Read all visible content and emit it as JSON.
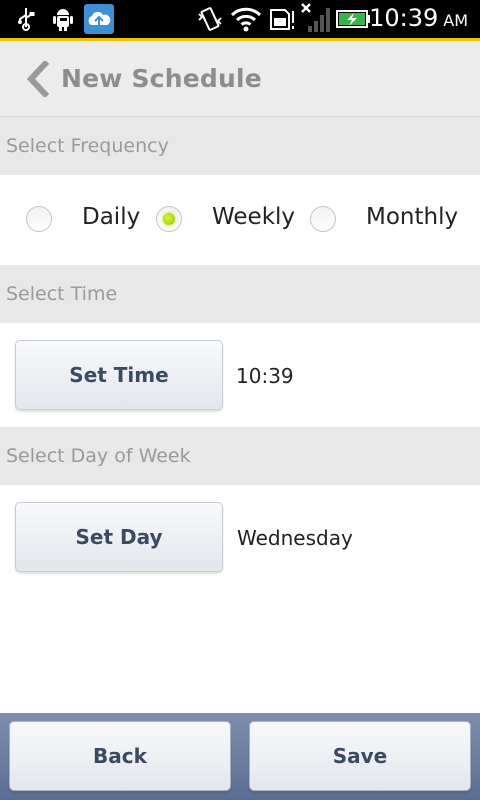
{
  "status_bar": {
    "time": "10:39",
    "ampm": "AM",
    "icons": [
      "usb-icon",
      "android-debug-icon",
      "cloud-upload-icon",
      "vibrate-icon",
      "wifi-icon",
      "sd-card-icon",
      "no-signal-icon",
      "battery-charging-icon"
    ],
    "accent_color": "#f2c200"
  },
  "header": {
    "title": "New Schedule",
    "back_icon": "chevron-left-icon"
  },
  "frequency": {
    "section_label": "Select Frequency",
    "options": [
      {
        "label": "Daily",
        "checked": false
      },
      {
        "label": "Weekly",
        "checked": true
      },
      {
        "label": "Monthly",
        "checked": false
      }
    ],
    "selected_color": "#a6d800"
  },
  "time": {
    "section_label": "Select Time",
    "button_label": "Set Time",
    "value": "10:39"
  },
  "day": {
    "section_label": "Select Day of Week",
    "button_label": "Set Day",
    "value": "Wednesday"
  },
  "footer": {
    "back_label": "Back",
    "save_label": "Save"
  }
}
